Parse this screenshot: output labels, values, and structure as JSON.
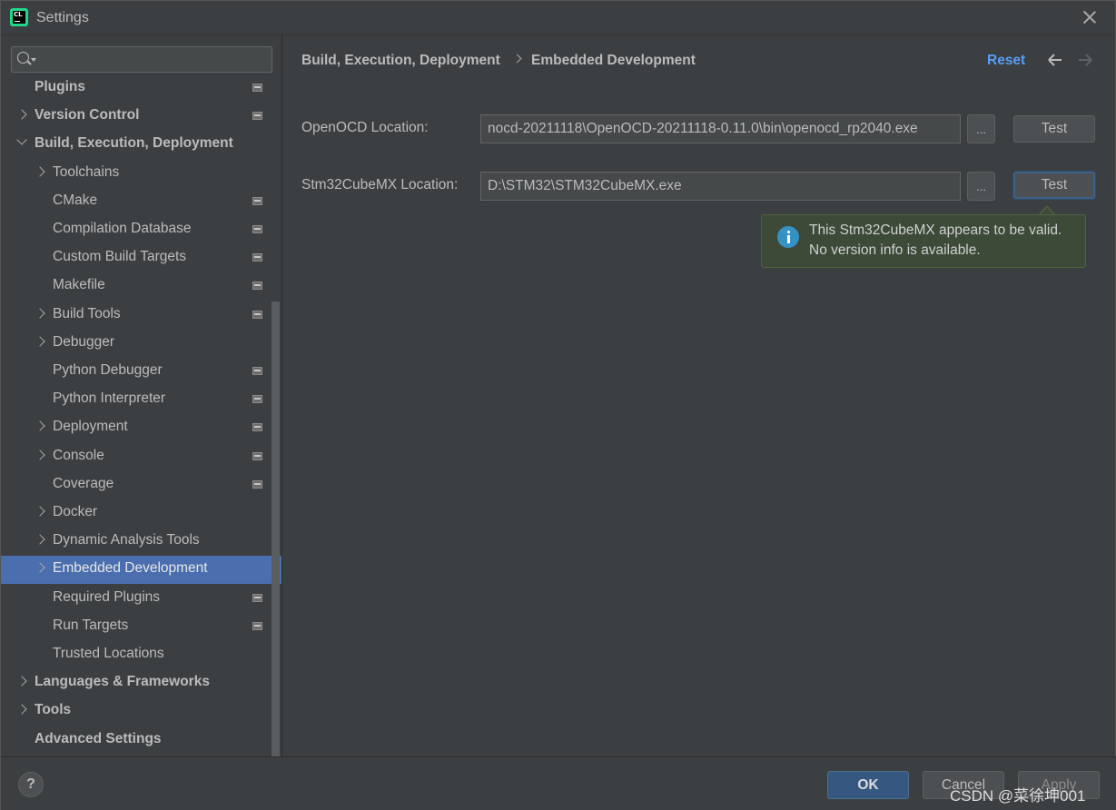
{
  "window": {
    "title": "Settings",
    "app_icon_text": "CL"
  },
  "search": {
    "value": "",
    "placeholder": ""
  },
  "sidebar": {
    "items": [
      {
        "label": "Plugins",
        "bold": true,
        "indent": 0,
        "chevron": "none",
        "project_icon": true
      },
      {
        "label": "Version Control",
        "bold": true,
        "indent": 0,
        "chevron": "right",
        "project_icon": true
      },
      {
        "label": "Build, Execution, Deployment",
        "bold": true,
        "indent": 0,
        "chevron": "down",
        "project_icon": false
      },
      {
        "label": "Toolchains",
        "bold": false,
        "indent": 1,
        "chevron": "right",
        "project_icon": false
      },
      {
        "label": "CMake",
        "bold": false,
        "indent": 1,
        "chevron": "none",
        "project_icon": true
      },
      {
        "label": "Compilation Database",
        "bold": false,
        "indent": 1,
        "chevron": "none",
        "project_icon": true
      },
      {
        "label": "Custom Build Targets",
        "bold": false,
        "indent": 1,
        "chevron": "none",
        "project_icon": true
      },
      {
        "label": "Makefile",
        "bold": false,
        "indent": 1,
        "chevron": "none",
        "project_icon": true
      },
      {
        "label": "Build Tools",
        "bold": false,
        "indent": 1,
        "chevron": "right",
        "project_icon": true
      },
      {
        "label": "Debugger",
        "bold": false,
        "indent": 1,
        "chevron": "right",
        "project_icon": false
      },
      {
        "label": "Python Debugger",
        "bold": false,
        "indent": 1,
        "chevron": "none",
        "project_icon": true
      },
      {
        "label": "Python Interpreter",
        "bold": false,
        "indent": 1,
        "chevron": "none",
        "project_icon": true
      },
      {
        "label": "Deployment",
        "bold": false,
        "indent": 1,
        "chevron": "right",
        "project_icon": true
      },
      {
        "label": "Console",
        "bold": false,
        "indent": 1,
        "chevron": "right",
        "project_icon": true
      },
      {
        "label": "Coverage",
        "bold": false,
        "indent": 1,
        "chevron": "none",
        "project_icon": true
      },
      {
        "label": "Docker",
        "bold": false,
        "indent": 1,
        "chevron": "right",
        "project_icon": false
      },
      {
        "label": "Dynamic Analysis Tools",
        "bold": false,
        "indent": 1,
        "chevron": "right",
        "project_icon": false
      },
      {
        "label": "Embedded Development",
        "bold": false,
        "indent": 1,
        "chevron": "right",
        "project_icon": false,
        "selected": true
      },
      {
        "label": "Required Plugins",
        "bold": false,
        "indent": 1,
        "chevron": "none",
        "project_icon": true
      },
      {
        "label": "Run Targets",
        "bold": false,
        "indent": 1,
        "chevron": "none",
        "project_icon": true
      },
      {
        "label": "Trusted Locations",
        "bold": false,
        "indent": 1,
        "chevron": "none",
        "project_icon": false
      },
      {
        "label": "Languages & Frameworks",
        "bold": true,
        "indent": 0,
        "chevron": "right",
        "project_icon": false
      },
      {
        "label": "Tools",
        "bold": true,
        "indent": 0,
        "chevron": "right",
        "project_icon": false
      },
      {
        "label": "Advanced Settings",
        "bold": true,
        "indent": 0,
        "chevron": "none",
        "project_icon": false
      }
    ]
  },
  "breadcrumb": {
    "parent": "Build, Execution, Deployment",
    "current": "Embedded Development"
  },
  "header": {
    "reset_label": "Reset"
  },
  "fields": {
    "openocd": {
      "label": "OpenOCD Location:",
      "value": "nocd-20211118\\OpenOCD-20211118-0.11.0\\bin\\openocd_rp2040.exe",
      "browse_label": "...",
      "test_label": "Test"
    },
    "stm32": {
      "label": "Stm32CubeMX Location:",
      "value": "D:\\STM32\\STM32CubeMX.exe",
      "browse_label": "...",
      "test_label": "Test"
    }
  },
  "balloon": {
    "line1": "This Stm32CubeMX appears to be valid.",
    "line2": "No version info is available."
  },
  "footer": {
    "help_label": "?",
    "ok_label": "OK",
    "cancel_label": "Cancel",
    "apply_label": "Apply",
    "watermark": "CSDN @菜徐坤001"
  },
  "colors": {
    "background": "#3c3f41",
    "selection": "#4b6eaf",
    "link": "#589df6",
    "info_balloon": "#3d4a38",
    "ok_button": "#365880"
  }
}
